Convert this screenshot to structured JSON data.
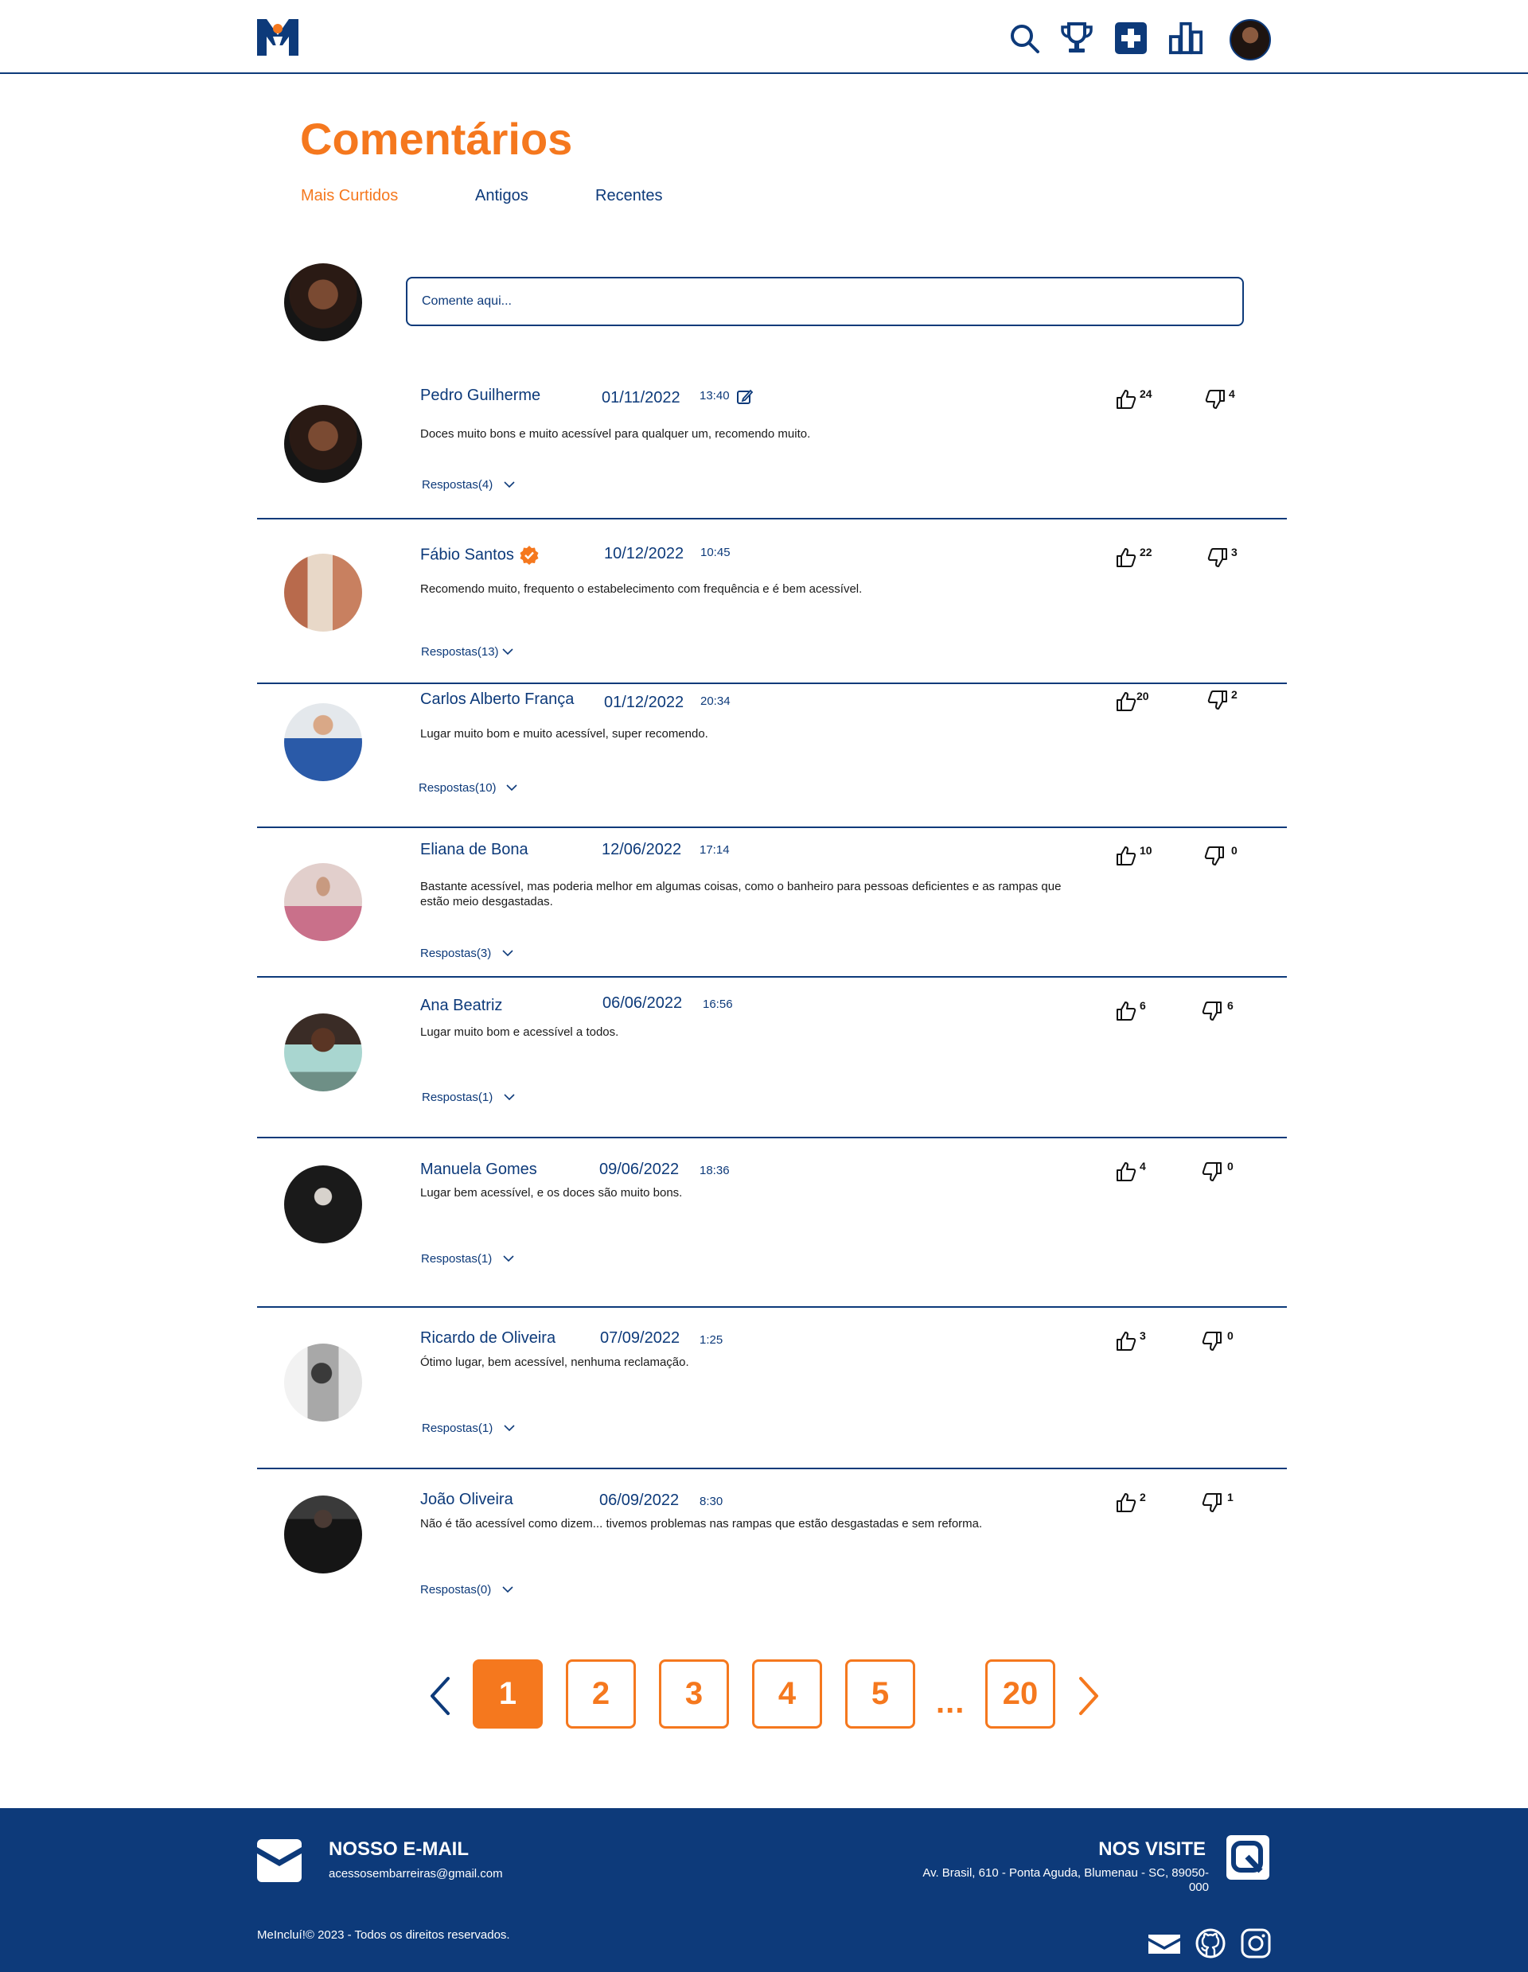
{
  "header": {
    "logo": "M-logo",
    "nav_icons": [
      "search-icon",
      "trophy-icon",
      "plus-square-icon",
      "bar-chart-icon"
    ],
    "colors": {
      "brand": "#0d3a7a",
      "accent": "#f5781e"
    }
  },
  "page": {
    "title": "Comentários",
    "tabs": [
      {
        "label": "Mais Curtidos",
        "active": true
      },
      {
        "label": "Antigos",
        "active": false
      },
      {
        "label": "Recentes",
        "active": false
      }
    ]
  },
  "composer": {
    "placeholder": "Comente aqui..."
  },
  "comments": [
    {
      "name": "Pedro Guilherme",
      "date": "01/11/2022",
      "time": "13:40",
      "text": "Doces muito bons e muito acessível para qualquer um, recomendo muito.",
      "replies": "Respostas(4)",
      "likes": "24",
      "dislikes": "4",
      "editable": true
    },
    {
      "name": "Fábio Santos",
      "date": "10/12/2022",
      "time": "10:45",
      "text": "Recomendo muito, frequento o estabelecimento com frequência e é bem acessível.",
      "replies": "Respostas(13)",
      "likes": "22",
      "dislikes": "3",
      "verified": true
    },
    {
      "name": "Carlos Alberto França",
      "date": "01/12/2022",
      "time": "20:34",
      "text": "Lugar muito bom e muito acessível, super recomendo.",
      "replies": "Respostas(10)",
      "likes": "20",
      "dislikes": "2"
    },
    {
      "name": "Eliana de Bona",
      "date": "12/06/2022",
      "time": "17:14",
      "text": "Bastante acessível, mas poderia melhor em algumas coisas, como o banheiro para pessoas deficientes e as rampas que estão meio desgastadas.",
      "replies": "Respostas(3)",
      "likes": "10",
      "dislikes": "0"
    },
    {
      "name": "Ana Beatriz",
      "date": "06/06/2022",
      "time": "16:56",
      "text": "Lugar muito bom e acessível a todos.",
      "replies": "Respostas(1)",
      "likes": "6",
      "dislikes": "6"
    },
    {
      "name": "Manuela Gomes",
      "date": "09/06/2022",
      "time": "18:36",
      "text": "Lugar bem acessível, e os doces são muito bons.",
      "replies": "Respostas(1)",
      "likes": "4",
      "dislikes": "0"
    },
    {
      "name": "Ricardo de Oliveira",
      "date": "07/09/2022",
      "time": "1:25",
      "text": "Ótimo lugar, bem acessível, nenhuma reclamação.",
      "replies": "Respostas(1)",
      "likes": "3",
      "dislikes": "0"
    },
    {
      "name": "João Oliveira",
      "date": "06/09/2022",
      "time": "8:30",
      "text": "Não é tão acessível como dizem... tivemos problemas nas rampas que estão desgastadas e sem reforma.",
      "replies": "Respostas(0)",
      "likes": "2",
      "dislikes": "1"
    }
  ],
  "pagination": {
    "pages": [
      "1",
      "2",
      "3",
      "4",
      "5"
    ],
    "current": "1",
    "ellipsis": "...",
    "last": "20"
  },
  "footer": {
    "email_title": "NOSSO E-MAIL",
    "email": "acessosembarreiras@gmail.com",
    "visit_title": "NOS VISITE",
    "address": "Av. Brasil, 610 - Ponta Aguda, Blumenau - SC, 89050-000",
    "copyright": "MeIncluí!© 2023 - Todos os direitos reservados.",
    "social_icons": [
      "mail-icon",
      "github-icon",
      "instagram-icon"
    ]
  }
}
